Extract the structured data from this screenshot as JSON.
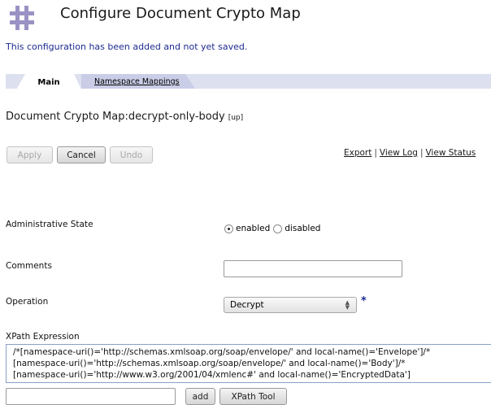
{
  "header": {
    "title": "Configure Document Crypto Map",
    "status_message": "This configuration has been added and not yet saved.",
    "logo_icon": "datapower-grid-logo-icon"
  },
  "tabs": [
    {
      "label": "Main",
      "active": true
    },
    {
      "label": "Namespace Mappings",
      "active": false
    }
  ],
  "object": {
    "title": "Document Crypto Map:decrypt-only-body",
    "up_link": "[up]"
  },
  "toolbar": {
    "apply_label": "Apply",
    "cancel_label": "Cancel",
    "undo_label": "Undo",
    "links": [
      "Export",
      "View Log",
      "View Status"
    ]
  },
  "form": {
    "admin_state": {
      "label": "Administrative State",
      "options": [
        "enabled",
        "disabled"
      ],
      "selected": "enabled"
    },
    "comments": {
      "label": "Comments",
      "value": ""
    },
    "operation": {
      "label": "Operation",
      "value": "Decrypt",
      "required_marker": "*"
    },
    "xpath": {
      "label": "XPath Expression",
      "lines": [
        "/*[namespace-uri()='http://schemas.xmlsoap.org/soap/envelope/' and local-name()='Envelope']/*",
        "[namespace-uri()='http://schemas.xmlsoap.org/soap/envelope/' and local-name()='Body']/*",
        "[namespace-uri()='http://www.w3.org/2001/04/xmlenc#' and local-name()='EncryptedData']"
      ],
      "input_value": "",
      "add_label": "add",
      "tool_label": "XPath Tool"
    }
  },
  "colors": {
    "accent_blue": "#1c2a8f",
    "tab_strip": "#dde0ef",
    "logo": "#9b92c4"
  }
}
